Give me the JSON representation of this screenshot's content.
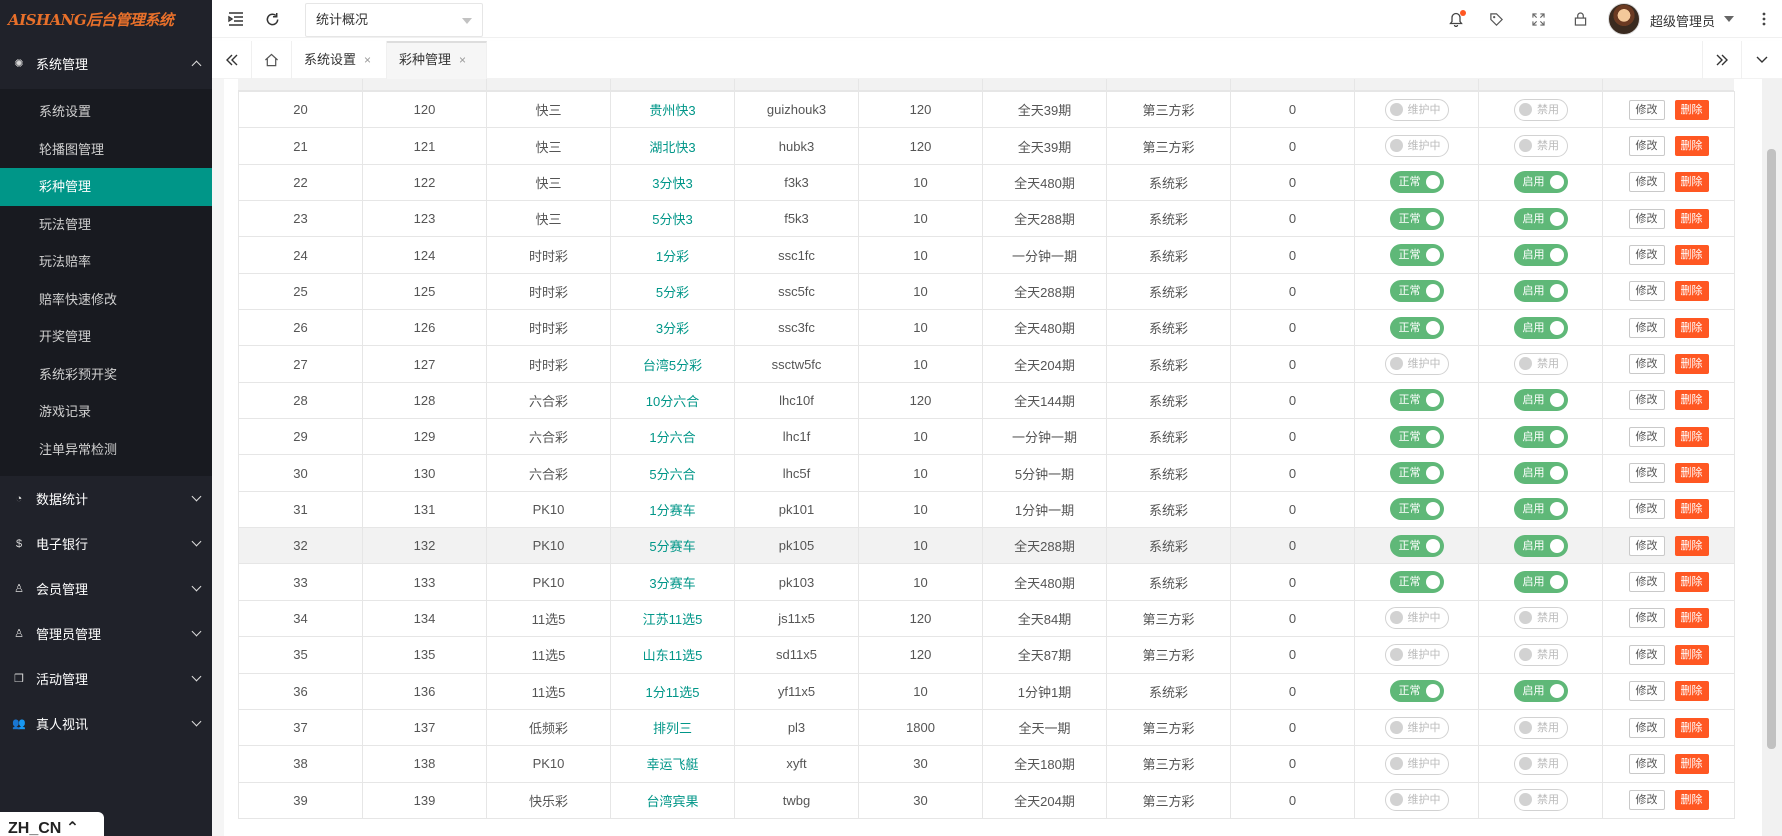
{
  "brand": {
    "logo_text": "AISHANG后台管理系统"
  },
  "sidebar": {
    "groups": [
      {
        "label": "系统管理",
        "icon": "gear-icon",
        "expanded": true,
        "items": [
          "系统设置",
          "轮播图管理",
          "彩种管理",
          "玩法管理",
          "玩法赔率",
          "赔率快速修改",
          "开奖管理",
          "系统彩预开奖",
          "游戏记录",
          "注单异常检测"
        ],
        "active_item": "彩种管理"
      },
      {
        "label": "数据统计",
        "icon": "dashboard-icon",
        "expanded": false
      },
      {
        "label": "电子银行",
        "icon": "dollar-icon",
        "expanded": false
      },
      {
        "label": "会员管理",
        "icon": "user-icon",
        "expanded": false
      },
      {
        "label": "管理员管理",
        "icon": "admin-icon",
        "expanded": false
      },
      {
        "label": "活动管理",
        "icon": "gift-icon",
        "expanded": false
      },
      {
        "label": "真人视讯",
        "icon": "users-icon",
        "expanded": false
      }
    ],
    "lang_badge": "ZH_CN ⌃"
  },
  "header": {
    "select_value": "统计概况",
    "username": "超级管理员",
    "icons": [
      "menu-fold-icon",
      "refresh-icon",
      "bell-icon",
      "tag-icon",
      "fullscreen-icon",
      "lock-icon",
      "more-icon"
    ]
  },
  "tabs": {
    "items": [
      {
        "label": "系统设置",
        "active": false
      },
      {
        "label": "彩种管理",
        "active": true
      }
    ],
    "close_glyph": "×"
  },
  "table": {
    "rows": [
      {
        "c1": "20",
        "c2": "120",
        "type": "快三",
        "name": "贵州快3",
        "code": "guizhouk3",
        "interval": "120",
        "periods": "全天39期",
        "source": "第三方彩",
        "sort": "0",
        "status": "off",
        "status_text": "维护中",
        "enable": "off",
        "enable_text": "禁用"
      },
      {
        "c1": "21",
        "c2": "121",
        "type": "快三",
        "name": "湖北快3",
        "code": "hubk3",
        "interval": "120",
        "periods": "全天39期",
        "source": "第三方彩",
        "sort": "0",
        "status": "off",
        "status_text": "维护中",
        "enable": "off",
        "enable_text": "禁用"
      },
      {
        "c1": "22",
        "c2": "122",
        "type": "快三",
        "name": "3分快3",
        "code": "f3k3",
        "interval": "10",
        "periods": "全天480期",
        "source": "系统彩",
        "sort": "0",
        "status": "on",
        "status_text": "正常",
        "enable": "on",
        "enable_text": "启用"
      },
      {
        "c1": "23",
        "c2": "123",
        "type": "快三",
        "name": "5分快3",
        "code": "f5k3",
        "interval": "10",
        "periods": "全天288期",
        "source": "系统彩",
        "sort": "0",
        "status": "on",
        "status_text": "正常",
        "enable": "on",
        "enable_text": "启用"
      },
      {
        "c1": "24",
        "c2": "124",
        "type": "时时彩",
        "name": "1分彩",
        "code": "ssc1fc",
        "interval": "10",
        "periods": "一分钟一期",
        "source": "系统彩",
        "sort": "0",
        "status": "on",
        "status_text": "正常",
        "enable": "on",
        "enable_text": "启用"
      },
      {
        "c1": "25",
        "c2": "125",
        "type": "时时彩",
        "name": "5分彩",
        "code": "ssc5fc",
        "interval": "10",
        "periods": "全天288期",
        "source": "系统彩",
        "sort": "0",
        "status": "on",
        "status_text": "正常",
        "enable": "on",
        "enable_text": "启用"
      },
      {
        "c1": "26",
        "c2": "126",
        "type": "时时彩",
        "name": "3分彩",
        "code": "ssc3fc",
        "interval": "10",
        "periods": "全天480期",
        "source": "系统彩",
        "sort": "0",
        "status": "on",
        "status_text": "正常",
        "enable": "on",
        "enable_text": "启用"
      },
      {
        "c1": "27",
        "c2": "127",
        "type": "时时彩",
        "name": "台湾5分彩",
        "code": "ssctw5fc",
        "interval": "10",
        "periods": "全天204期",
        "source": "系统彩",
        "sort": "0",
        "status": "off",
        "status_text": "维护中",
        "enable": "off",
        "enable_text": "禁用"
      },
      {
        "c1": "28",
        "c2": "128",
        "type": "六合彩",
        "name": "10分六合",
        "code": "lhc10f",
        "interval": "120",
        "periods": "全天144期",
        "source": "系统彩",
        "sort": "0",
        "status": "on",
        "status_text": "正常",
        "enable": "on",
        "enable_text": "启用"
      },
      {
        "c1": "29",
        "c2": "129",
        "type": "六合彩",
        "name": "1分六合",
        "code": "lhc1f",
        "interval": "10",
        "periods": "一分钟一期",
        "source": "系统彩",
        "sort": "0",
        "status": "on",
        "status_text": "正常",
        "enable": "on",
        "enable_text": "启用"
      },
      {
        "c1": "30",
        "c2": "130",
        "type": "六合彩",
        "name": "5分六合",
        "code": "lhc5f",
        "interval": "10",
        "periods": "5分钟一期",
        "source": "系统彩",
        "sort": "0",
        "status": "on",
        "status_text": "正常",
        "enable": "on",
        "enable_text": "启用"
      },
      {
        "c1": "31",
        "c2": "131",
        "type": "PK10",
        "name": "1分赛车",
        "code": "pk101",
        "interval": "10",
        "periods": "1分钟一期",
        "source": "系统彩",
        "sort": "0",
        "status": "on",
        "status_text": "正常",
        "enable": "on",
        "enable_text": "启用"
      },
      {
        "c1": "32",
        "c2": "132",
        "type": "PK10",
        "name": "5分赛车",
        "code": "pk105",
        "interval": "10",
        "periods": "全天288期",
        "source": "系统彩",
        "sort": "0",
        "status": "on",
        "status_text": "正常",
        "enable": "on",
        "enable_text": "启用",
        "highlight": true
      },
      {
        "c1": "33",
        "c2": "133",
        "type": "PK10",
        "name": "3分赛车",
        "code": "pk103",
        "interval": "10",
        "periods": "全天480期",
        "source": "系统彩",
        "sort": "0",
        "status": "on",
        "status_text": "正常",
        "enable": "on",
        "enable_text": "启用"
      },
      {
        "c1": "34",
        "c2": "134",
        "type": "11选5",
        "name": "江苏11选5",
        "code": "js11x5",
        "interval": "120",
        "periods": "全天84期",
        "source": "第三方彩",
        "sort": "0",
        "status": "off",
        "status_text": "维护中",
        "enable": "off",
        "enable_text": "禁用"
      },
      {
        "c1": "35",
        "c2": "135",
        "type": "11选5",
        "name": "山东11选5",
        "code": "sd11x5",
        "interval": "120",
        "periods": "全天87期",
        "source": "第三方彩",
        "sort": "0",
        "status": "off",
        "status_text": "维护中",
        "enable": "off",
        "enable_text": "禁用"
      },
      {
        "c1": "36",
        "c2": "136",
        "type": "11选5",
        "name": "1分11选5",
        "code": "yf11x5",
        "interval": "10",
        "periods": "1分钟1期",
        "source": "系统彩",
        "sort": "0",
        "status": "on",
        "status_text": "正常",
        "enable": "on",
        "enable_text": "启用"
      },
      {
        "c1": "37",
        "c2": "137",
        "type": "低频彩",
        "name": "排列三",
        "code": "pl3",
        "interval": "1800",
        "periods": "全天一期",
        "source": "第三方彩",
        "sort": "0",
        "status": "off",
        "status_text": "维护中",
        "enable": "off",
        "enable_text": "禁用"
      },
      {
        "c1": "38",
        "c2": "138",
        "type": "PK10",
        "name": "幸运飞艇",
        "code": "xyft",
        "interval": "30",
        "periods": "全天180期",
        "source": "第三方彩",
        "sort": "0",
        "status": "off",
        "status_text": "维护中",
        "enable": "off",
        "enable_text": "禁用"
      },
      {
        "c1": "39",
        "c2": "139",
        "type": "快乐彩",
        "name": "台湾宾果",
        "code": "twbg",
        "interval": "30",
        "periods": "全天204期",
        "source": "第三方彩",
        "sort": "0",
        "status": "off",
        "status_text": "维护中",
        "enable": "off",
        "enable_text": "禁用"
      }
    ],
    "edit_label": "修改",
    "delete_label": "删除"
  },
  "colors": {
    "sidebar_bg": "#20222a",
    "accent": "#009688",
    "switch_on": "#5fb878",
    "danger": "#ff5722"
  }
}
